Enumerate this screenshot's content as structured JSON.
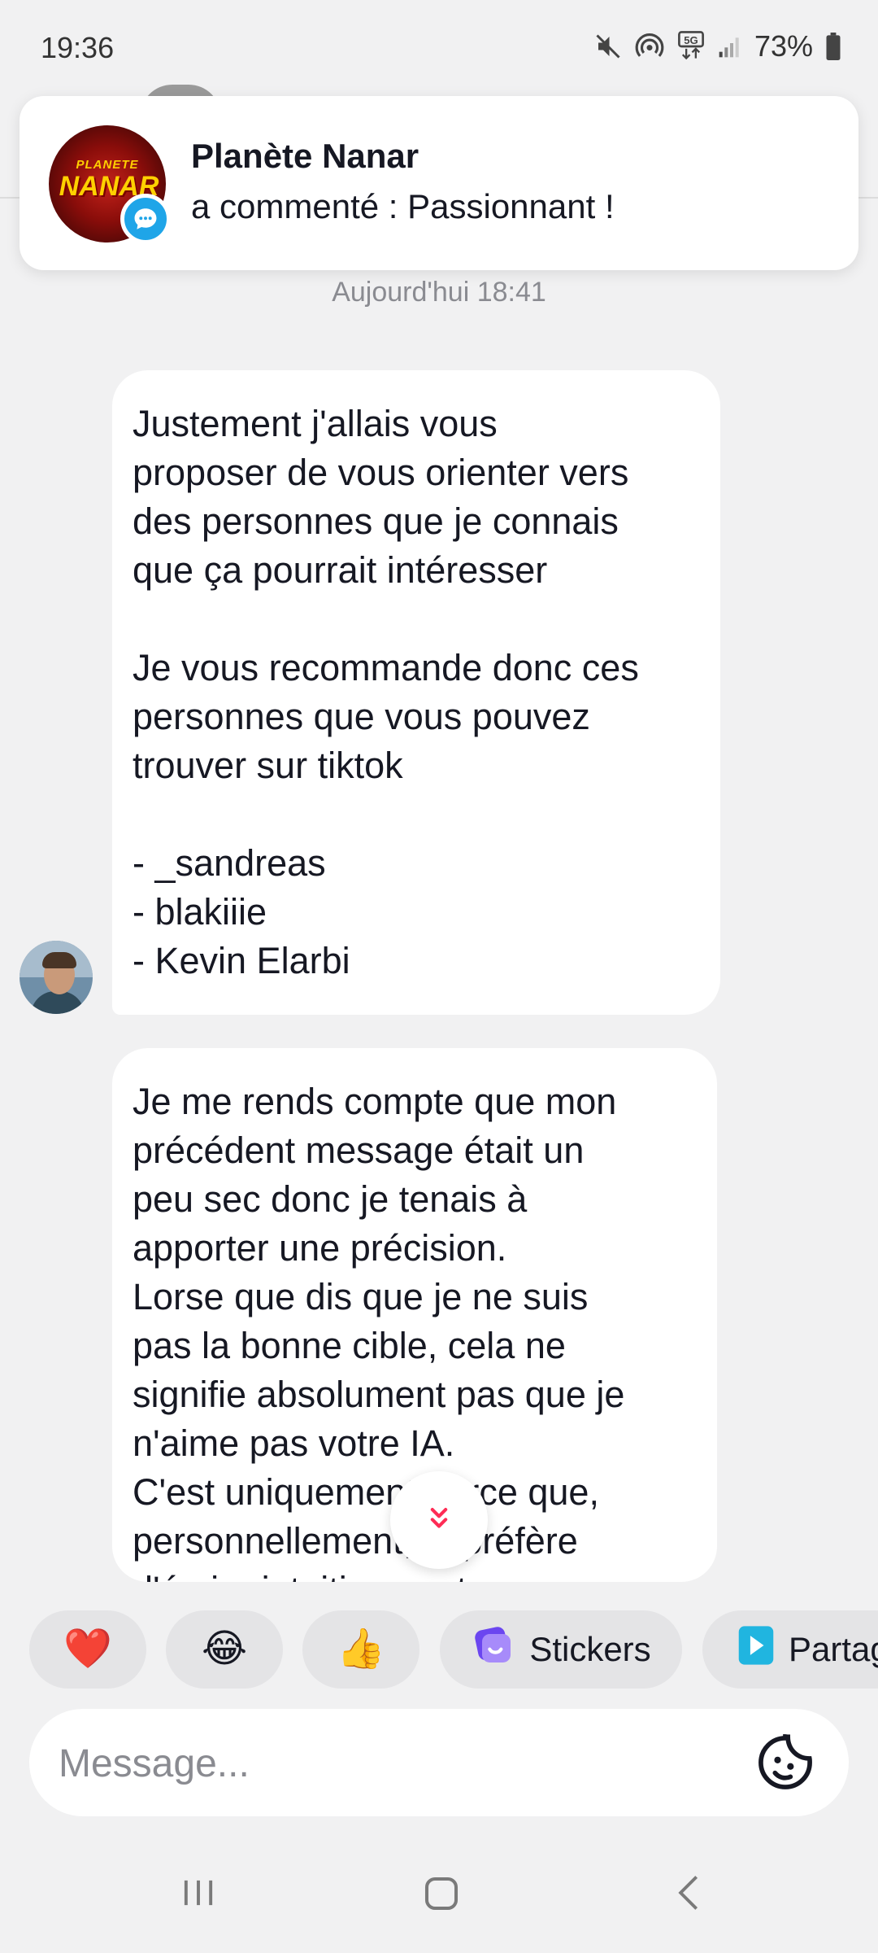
{
  "status_bar": {
    "time": "19:36",
    "battery": "73%",
    "network": "5G"
  },
  "notification": {
    "sender": "Planète Nanar",
    "text": "a commenté : Passionnant !",
    "avatar_logo_top": "PLANETE",
    "avatar_logo_main": "NANAR"
  },
  "chat": {
    "date_label": "Aujourd'hui 18:41",
    "messages": [
      {
        "text": "Justement j'allais vous\nproposer de vous orienter vers\ndes personnes que je connais\nque ça pourrait intéresser\n\nJe vous recommande donc ces\npersonnes que vous pouvez\ntrouver sur tiktok\n\n-  _sandreas\n- blakiiie\n- Kevin Elarbi"
      },
      {
        "text": "Je me rends compte que mon\nprécédent message était un\npeu sec donc je tenais à\napporter une précision.\nLorse que dis que je ne suis\npas la bonne cible, cela ne\nsignifie absolument pas que je\nn'aime pas votre IA.\nC'est uniquement parce que,\npersonnellement, je préfère\nd'écrire intuitivement."
      }
    ]
  },
  "quick_reactions": {
    "heart": "❤️",
    "laugh": "😂",
    "thumb": "👍",
    "stickers_label": "Stickers",
    "share_label": "Partag"
  },
  "composer": {
    "placeholder": "Message..."
  },
  "colors": {
    "accent_blue": "#1fa5e8",
    "scroll_red": "#fe2c55",
    "stickers_purple": "#8b5cf6",
    "share_teal": "#20b5e0"
  }
}
